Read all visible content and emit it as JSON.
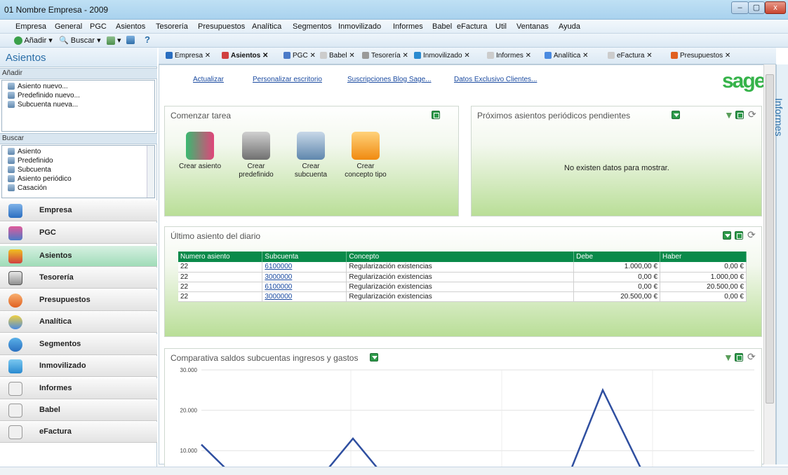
{
  "window": {
    "title": "01 Nombre Empresa  - 2009",
    "min": "–",
    "max": "▢",
    "close": "x"
  },
  "menu": [
    "Empresa",
    "General",
    "PGC",
    "Asientos",
    "Tesorería",
    "Presupuestos",
    "Analítica",
    "Segmentos",
    "Inmovilizado",
    "Informes",
    "Babel",
    "eFactura",
    "Util",
    "Ventanas",
    "Ayuda"
  ],
  "toolbar": {
    "add": "Añadir",
    "search": "Buscar",
    "help": "?"
  },
  "left": {
    "title": "Asientos",
    "add_section": "Añadir",
    "add_items": [
      "Asiento nuevo...",
      "Predefinido nuevo...",
      "Subcuenta nueva..."
    ],
    "search_section": "Buscar",
    "search_items": [
      "Asiento",
      "Predefinido",
      "Subcuenta",
      "Asiento periódico",
      "Casación"
    ],
    "nav": [
      "Empresa",
      "PGC",
      "Asientos",
      "Tesorería",
      "Presupuestos",
      "Analítica",
      "Segmentos",
      "Inmovilizado",
      "Informes",
      "Babel",
      "eFactura"
    ]
  },
  "tabs": [
    "Empresa",
    "Asientos",
    "PGC",
    "Babel",
    "Tesorería",
    "Inmovilizado",
    "Informes",
    "Analítica",
    "eFactura",
    "Presupuestos"
  ],
  "links": [
    "Actualizar",
    "Personalizar escritorio",
    "Suscripciones Blog Sage...",
    "Datos Exclusivo Clientes..."
  ],
  "logo": "sage",
  "right_panel": "Informes",
  "panel_tasks": {
    "title": "Comenzar tarea",
    "items": [
      {
        "line1": "Crear asiento",
        "line2": "",
        "color": "#e0457a"
      },
      {
        "line1": "Crear",
        "line2": "predefinido",
        "color": "#8a8a8a"
      },
      {
        "line1": "Crear",
        "line2": "subcuenta",
        "color": "#6f9bc7"
      },
      {
        "line1": "Crear",
        "line2": "concepto tipo",
        "color": "#f0a020"
      }
    ]
  },
  "panel_periodic": {
    "title": "Próximos asientos periódicos pendientes",
    "empty": "No existen datos para mostrar."
  },
  "panel_diary": {
    "title": "Último asiento del diario",
    "headers": [
      "Numero asiento",
      "Subcuenta",
      "Concepto",
      "Debe",
      "Haber"
    ],
    "rows": [
      [
        "22",
        "6100000",
        "Regularización existencias",
        "1.000,00 €",
        "0,00 €"
      ],
      [
        "22",
        "3000000",
        "Regularización existencias",
        "0,00 €",
        "1.000,00 €"
      ],
      [
        "22",
        "6100000",
        "Regularización existencias",
        "0,00 €",
        "20.500,00 €"
      ],
      [
        "22",
        "3000000",
        "Regularización existencias",
        "20.500,00 €",
        "0,00 €"
      ]
    ]
  },
  "panel_chart": {
    "title": "Comparativa saldos subcuentas ingresos y gastos"
  },
  "chart_data": {
    "type": "line",
    "title": "Comparativa saldos subcuentas ingresos y gastos",
    "ylim": [
      5000,
      30000
    ],
    "yticks": [
      "30.000",
      "20.000",
      "10.000"
    ],
    "series": [
      {
        "values": [
          11500,
          5000,
          5000,
          13000,
          5000,
          5000,
          5000,
          25000,
          5000
        ]
      }
    ],
    "color": "#2f4fa0"
  }
}
